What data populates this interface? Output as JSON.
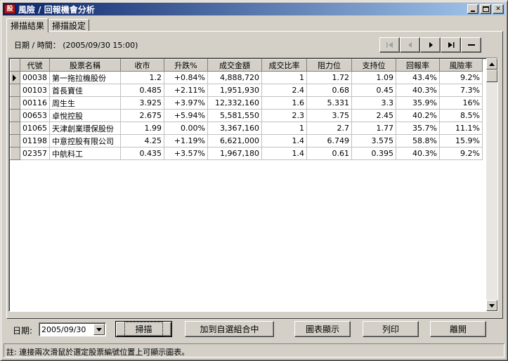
{
  "window": {
    "title": "風險 / 回報機會分析",
    "app_icon_glyph": "股"
  },
  "tabs": [
    {
      "label": "掃描結果",
      "active": true
    },
    {
      "label": "掃描設定",
      "active": false
    }
  ],
  "header": {
    "datetime_label": "日期 / 時間：",
    "datetime_value": "(2005/09/30 15:00)"
  },
  "navigation": {
    "first_icon": "first-record-icon",
    "prev_icon": "prev-record-icon",
    "next_icon": "next-record-icon",
    "last_icon": "last-record-icon",
    "delete_icon": "delete-record-icon"
  },
  "table": {
    "columns": [
      "代號",
      "股票名稱",
      "收市",
      "升跌%",
      "成交金額",
      "成交比率",
      "阻力位",
      "支持位",
      "回報率",
      "風險率"
    ],
    "rows": [
      [
        "00038",
        "第一拖拉機股份",
        "1.2",
        "+0.84%",
        "4,888,720",
        "1",
        "1.72",
        "1.09",
        "43.4%",
        "9.2%"
      ],
      [
        "00103",
        "首長寶佳",
        "0.485",
        "+2.11%",
        "1,951,930",
        "2.4",
        "0.68",
        "0.45",
        "40.3%",
        "7.3%"
      ],
      [
        "00116",
        "周生生",
        "3.925",
        "+3.97%",
        "12,332,160",
        "1.6",
        "5.331",
        "3.3",
        "35.9%",
        "16%"
      ],
      [
        "00653",
        "卓悅控股",
        "2.675",
        "+5.94%",
        "5,581,550",
        "2.3",
        "3.75",
        "2.45",
        "40.2%",
        "8.5%"
      ],
      [
        "01065",
        "天津創業環保股份",
        "1.99",
        "0.00%",
        "3,367,160",
        "1",
        "2.7",
        "1.77",
        "35.7%",
        "11.1%"
      ],
      [
        "01198",
        "中意控股有限公司",
        "4.25",
        "+1.19%",
        "6,621,000",
        "1.4",
        "6.749",
        "3.575",
        "58.8%",
        "15.9%"
      ],
      [
        "02357",
        "中航科工",
        "0.435",
        "+3.57%",
        "1,967,180",
        "1.4",
        "0.61",
        "0.395",
        "40.3%",
        "9.2%"
      ]
    ],
    "selected_row": 0
  },
  "footer": {
    "date_label": "日期:",
    "date_value": "2005/09/30",
    "scan_label": "掃描",
    "add_portfolio_label": "加到自選組合中",
    "chart_label": "圖表顯示",
    "print_label": "列印",
    "exit_label": "離開"
  },
  "status": {
    "note": "註: 連接兩次滑鼠於選定股票編號位置上可顯示圖表。"
  }
}
